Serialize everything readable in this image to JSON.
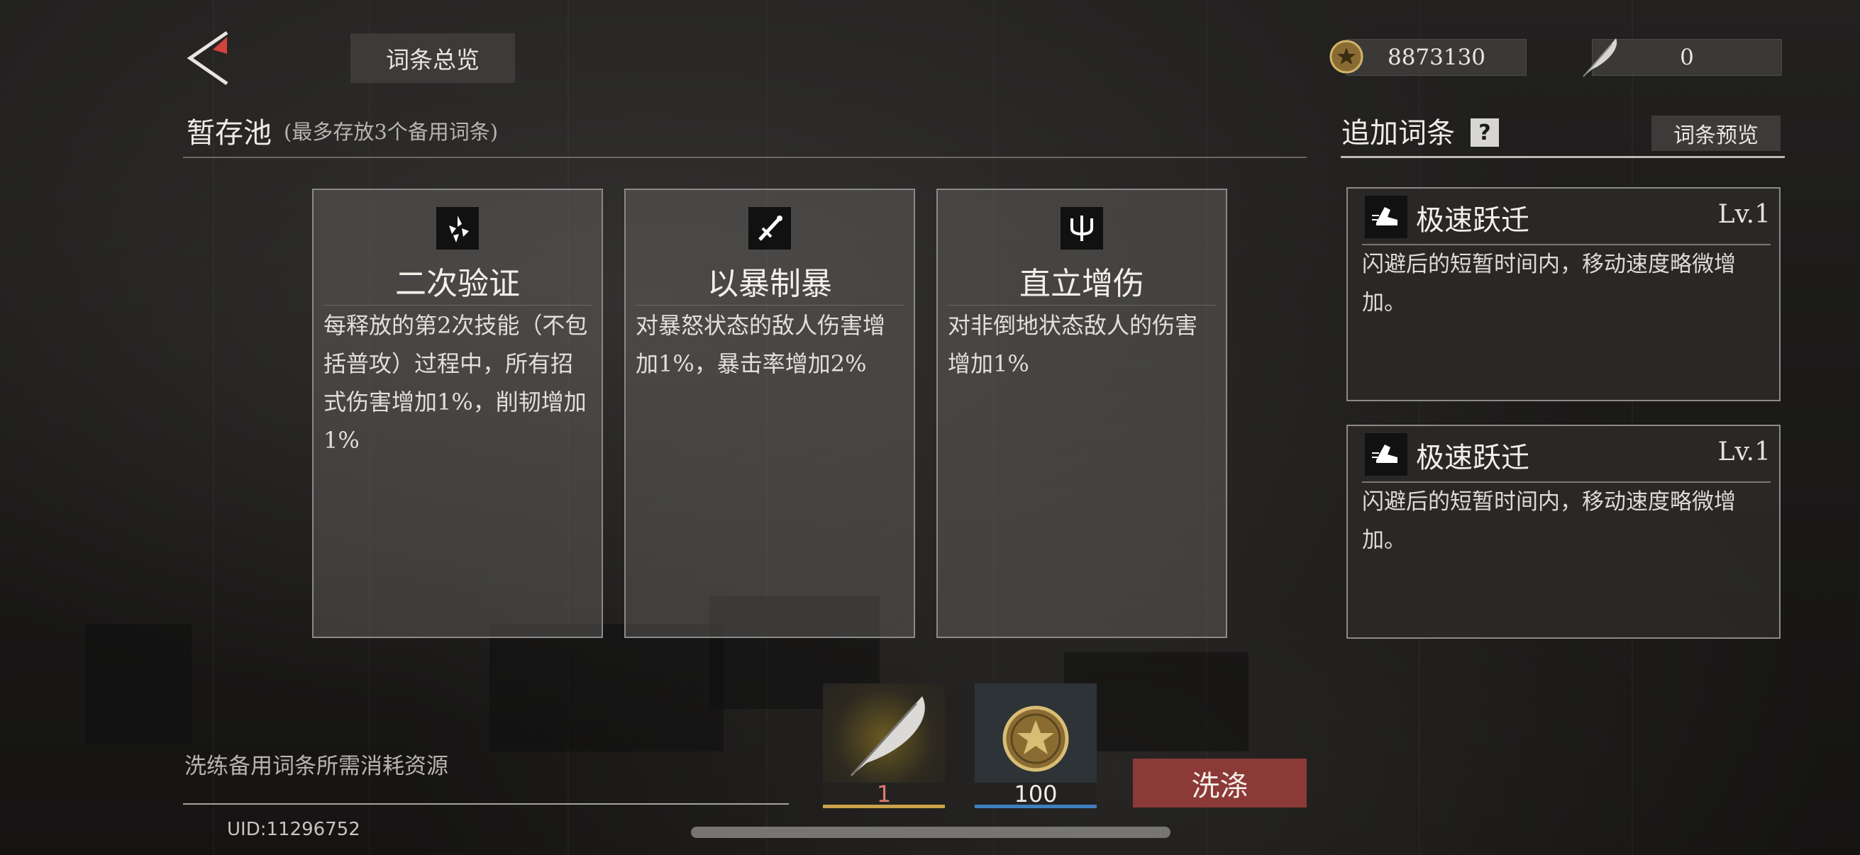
{
  "topbar": {
    "overview_label": "词条总览",
    "coin_value": "8873130",
    "feather_value": "0"
  },
  "pool": {
    "title": "暂存池",
    "subtitle": "(最多存放3个备用词条)",
    "cards": [
      {
        "icon": "shards-icon",
        "title": "二次验证",
        "desc": "每释放的第2次技能（不包括普攻）过程中，所有招式伤害增加1%，削韧增加1%"
      },
      {
        "icon": "sword-icon",
        "title": "以暴制暴",
        "desc": "对暴怒状态的敌人伤害增加1%，暴击率增加2%"
      },
      {
        "icon": "trident-icon",
        "title": "直立增伤",
        "desc": "对非倒地状态敌人的伤害增加1%"
      }
    ]
  },
  "additional": {
    "title": "追加词条",
    "help_label": "?",
    "preview_label": "词条预览",
    "slots": [
      {
        "icon": "boot-icon",
        "name": "极速跃迁",
        "level": "Lv.1",
        "desc": "闪避后的短暂时间内，移动速度略微增加。"
      },
      {
        "icon": "boot-icon",
        "name": "极速跃迁",
        "level": "Lv.1",
        "desc": "闪避后的短暂时间内，移动速度略微增加。"
      }
    ]
  },
  "cost": {
    "label": "洗练备用词条所需消耗资源",
    "items": [
      {
        "icon": "feather-icon",
        "qty": "1",
        "qty_color": "#e07a6e",
        "bar_color": "#c9a24a"
      },
      {
        "icon": "coin-icon",
        "qty": "100",
        "qty_color": "#f0ede8",
        "bar_color": "#3f7fc0"
      }
    ],
    "wash_label": "洗涤"
  },
  "uid": "UID:11296752",
  "colors": {
    "accent_red": "#8c3a37",
    "coin_gold": "#b8954a"
  }
}
